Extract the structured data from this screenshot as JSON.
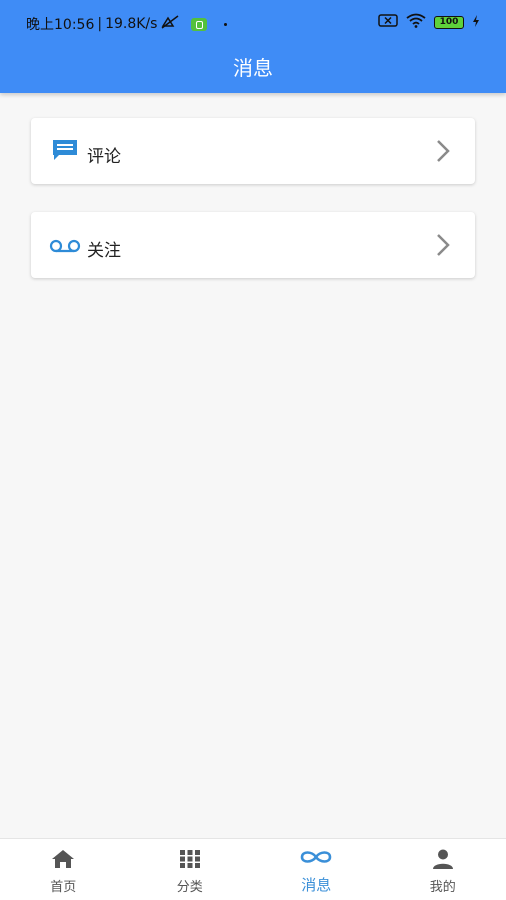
{
  "status_bar": {
    "time": "晚上10:56",
    "separator": "|",
    "speed": "19.8K/s",
    "battery": "100"
  },
  "header": {
    "title": "消息"
  },
  "items": [
    {
      "label": "评论",
      "icon": "comment-icon"
    },
    {
      "label": "关注",
      "icon": "voicemail-icon"
    }
  ],
  "tabbar": {
    "tabs": [
      {
        "label": "首页",
        "icon": "home-icon"
      },
      {
        "label": "分类",
        "icon": "grid-icon"
      },
      {
        "label": "消息",
        "icon": "infinity-icon",
        "active": true
      },
      {
        "label": "我的",
        "icon": "person-icon"
      }
    ]
  },
  "colors": {
    "header_bg": "#3f8cf6",
    "accent_icon": "#3a8fd8",
    "page_bg": "#f7f7f7"
  }
}
